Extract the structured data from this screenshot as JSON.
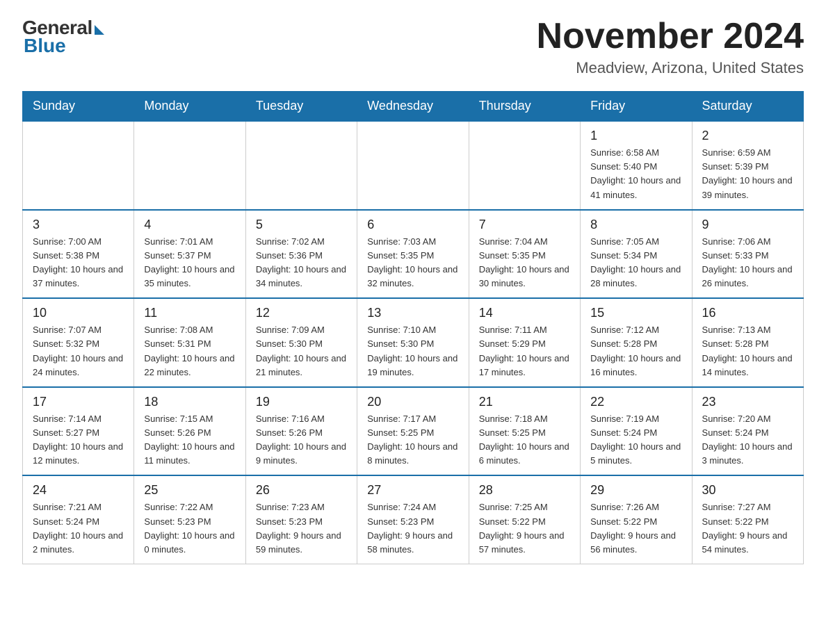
{
  "header": {
    "logo_general": "General",
    "logo_blue": "Blue",
    "title": "November 2024",
    "location": "Meadview, Arizona, United States"
  },
  "days_of_week": [
    "Sunday",
    "Monday",
    "Tuesday",
    "Wednesday",
    "Thursday",
    "Friday",
    "Saturday"
  ],
  "weeks": [
    [
      {
        "day": "",
        "info": ""
      },
      {
        "day": "",
        "info": ""
      },
      {
        "day": "",
        "info": ""
      },
      {
        "day": "",
        "info": ""
      },
      {
        "day": "",
        "info": ""
      },
      {
        "day": "1",
        "info": "Sunrise: 6:58 AM\nSunset: 5:40 PM\nDaylight: 10 hours and 41 minutes."
      },
      {
        "day": "2",
        "info": "Sunrise: 6:59 AM\nSunset: 5:39 PM\nDaylight: 10 hours and 39 minutes."
      }
    ],
    [
      {
        "day": "3",
        "info": "Sunrise: 7:00 AM\nSunset: 5:38 PM\nDaylight: 10 hours and 37 minutes."
      },
      {
        "day": "4",
        "info": "Sunrise: 7:01 AM\nSunset: 5:37 PM\nDaylight: 10 hours and 35 minutes."
      },
      {
        "day": "5",
        "info": "Sunrise: 7:02 AM\nSunset: 5:36 PM\nDaylight: 10 hours and 34 minutes."
      },
      {
        "day": "6",
        "info": "Sunrise: 7:03 AM\nSunset: 5:35 PM\nDaylight: 10 hours and 32 minutes."
      },
      {
        "day": "7",
        "info": "Sunrise: 7:04 AM\nSunset: 5:35 PM\nDaylight: 10 hours and 30 minutes."
      },
      {
        "day": "8",
        "info": "Sunrise: 7:05 AM\nSunset: 5:34 PM\nDaylight: 10 hours and 28 minutes."
      },
      {
        "day": "9",
        "info": "Sunrise: 7:06 AM\nSunset: 5:33 PM\nDaylight: 10 hours and 26 minutes."
      }
    ],
    [
      {
        "day": "10",
        "info": "Sunrise: 7:07 AM\nSunset: 5:32 PM\nDaylight: 10 hours and 24 minutes."
      },
      {
        "day": "11",
        "info": "Sunrise: 7:08 AM\nSunset: 5:31 PM\nDaylight: 10 hours and 22 minutes."
      },
      {
        "day": "12",
        "info": "Sunrise: 7:09 AM\nSunset: 5:30 PM\nDaylight: 10 hours and 21 minutes."
      },
      {
        "day": "13",
        "info": "Sunrise: 7:10 AM\nSunset: 5:30 PM\nDaylight: 10 hours and 19 minutes."
      },
      {
        "day": "14",
        "info": "Sunrise: 7:11 AM\nSunset: 5:29 PM\nDaylight: 10 hours and 17 minutes."
      },
      {
        "day": "15",
        "info": "Sunrise: 7:12 AM\nSunset: 5:28 PM\nDaylight: 10 hours and 16 minutes."
      },
      {
        "day": "16",
        "info": "Sunrise: 7:13 AM\nSunset: 5:28 PM\nDaylight: 10 hours and 14 minutes."
      }
    ],
    [
      {
        "day": "17",
        "info": "Sunrise: 7:14 AM\nSunset: 5:27 PM\nDaylight: 10 hours and 12 minutes."
      },
      {
        "day": "18",
        "info": "Sunrise: 7:15 AM\nSunset: 5:26 PM\nDaylight: 10 hours and 11 minutes."
      },
      {
        "day": "19",
        "info": "Sunrise: 7:16 AM\nSunset: 5:26 PM\nDaylight: 10 hours and 9 minutes."
      },
      {
        "day": "20",
        "info": "Sunrise: 7:17 AM\nSunset: 5:25 PM\nDaylight: 10 hours and 8 minutes."
      },
      {
        "day": "21",
        "info": "Sunrise: 7:18 AM\nSunset: 5:25 PM\nDaylight: 10 hours and 6 minutes."
      },
      {
        "day": "22",
        "info": "Sunrise: 7:19 AM\nSunset: 5:24 PM\nDaylight: 10 hours and 5 minutes."
      },
      {
        "day": "23",
        "info": "Sunrise: 7:20 AM\nSunset: 5:24 PM\nDaylight: 10 hours and 3 minutes."
      }
    ],
    [
      {
        "day": "24",
        "info": "Sunrise: 7:21 AM\nSunset: 5:24 PM\nDaylight: 10 hours and 2 minutes."
      },
      {
        "day": "25",
        "info": "Sunrise: 7:22 AM\nSunset: 5:23 PM\nDaylight: 10 hours and 0 minutes."
      },
      {
        "day": "26",
        "info": "Sunrise: 7:23 AM\nSunset: 5:23 PM\nDaylight: 9 hours and 59 minutes."
      },
      {
        "day": "27",
        "info": "Sunrise: 7:24 AM\nSunset: 5:23 PM\nDaylight: 9 hours and 58 minutes."
      },
      {
        "day": "28",
        "info": "Sunrise: 7:25 AM\nSunset: 5:22 PM\nDaylight: 9 hours and 57 minutes."
      },
      {
        "day": "29",
        "info": "Sunrise: 7:26 AM\nSunset: 5:22 PM\nDaylight: 9 hours and 56 minutes."
      },
      {
        "day": "30",
        "info": "Sunrise: 7:27 AM\nSunset: 5:22 PM\nDaylight: 9 hours and 54 minutes."
      }
    ]
  ]
}
